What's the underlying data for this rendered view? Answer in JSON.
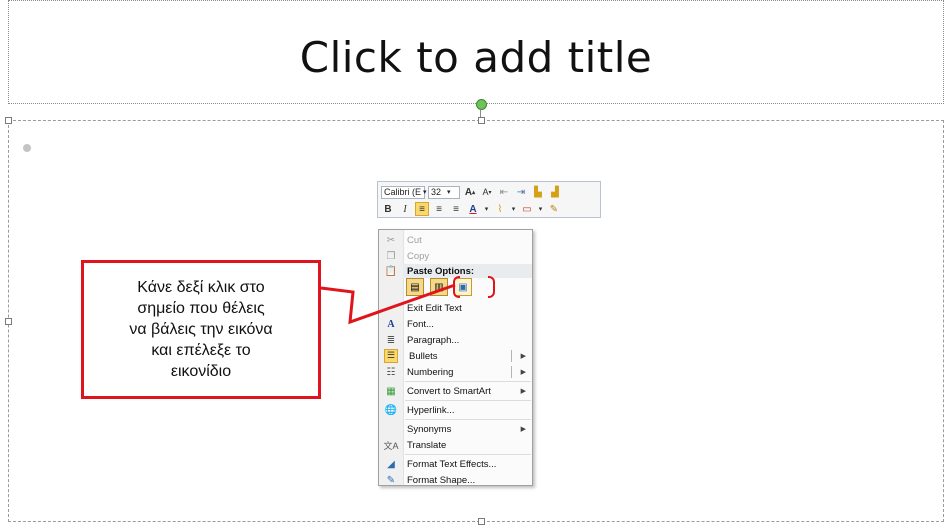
{
  "slide": {
    "title_placeholder": "Click to add title"
  },
  "mini_toolbar": {
    "font_name": "Calibri (E",
    "font_size": "32",
    "row1_buttons": [
      "grow-font-icon",
      "shrink-font-icon",
      "decrease-indent-icon",
      "increase-indent-icon",
      "copy-format-icon",
      "paste-format-icon"
    ],
    "row2": {
      "bold": "B",
      "italic": "I",
      "font_color_letter": "A"
    }
  },
  "context_menu": {
    "cut": "Cut",
    "copy": "Copy",
    "paste_header": "Paste Options:",
    "exit_edit": "Exit Edit Text",
    "font": "Font...",
    "paragraph": "Paragraph...",
    "bullets": "Bullets",
    "numbering": "Numbering",
    "smartart": "Convert to SmartArt",
    "hyperlink": "Hyperlink...",
    "synonyms": "Synonyms",
    "translate": "Translate",
    "text_effects": "Format Text Effects...",
    "format_shape": "Format Shape..."
  },
  "annotation": {
    "text": "Κάνε δεξί κλικ στο\nσημείο που θέλεις\nνα βάλεις την εικόνα\nκαι επέλεξε το\nεικονίδιο",
    "color": "#e0141c"
  }
}
